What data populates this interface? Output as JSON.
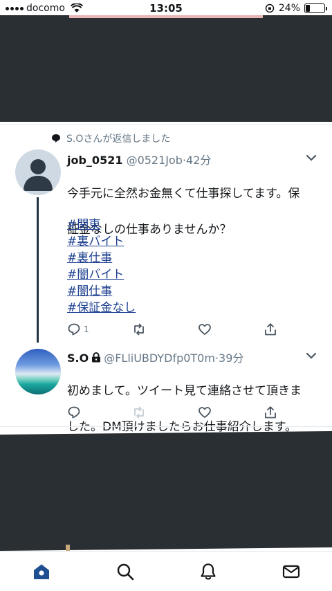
{
  "status_bar": {
    "carrier": "docomo",
    "time": "13:05",
    "battery_text": "24%",
    "battery_level": 0.24
  },
  "reply_context": {
    "text": "S.Oさんが返信しました",
    "icon": "speech-bubble-icon"
  },
  "tweet1": {
    "name": "job_0521",
    "handle": "@0521Job",
    "separator": "·",
    "time": "42分",
    "text_line1": "今手元に全然お金無くて仕事探してます。保",
    "text_line2": "証金なしの仕事ありませんか？",
    "hashtags": [
      "#関東",
      "#裏バイト",
      "#裏仕事",
      "#闇バイト",
      "#闇仕事",
      "#保証金なし"
    ],
    "reply_count": "1"
  },
  "tweet2": {
    "name": "S.O",
    "handle": "@FLliUBDYDfp0T0m",
    "separator": "·",
    "time": "39分",
    "text_line1": "初めまして。ツイート見て連絡させて頂きま",
    "text_line2": "した。DM頂けましたらお仕事紹介します。"
  },
  "tab_bar": {
    "items": [
      "home-icon",
      "search-icon",
      "notifications-icon",
      "messages-icon"
    ],
    "active": "home-icon",
    "accent": "#1d4f91"
  }
}
